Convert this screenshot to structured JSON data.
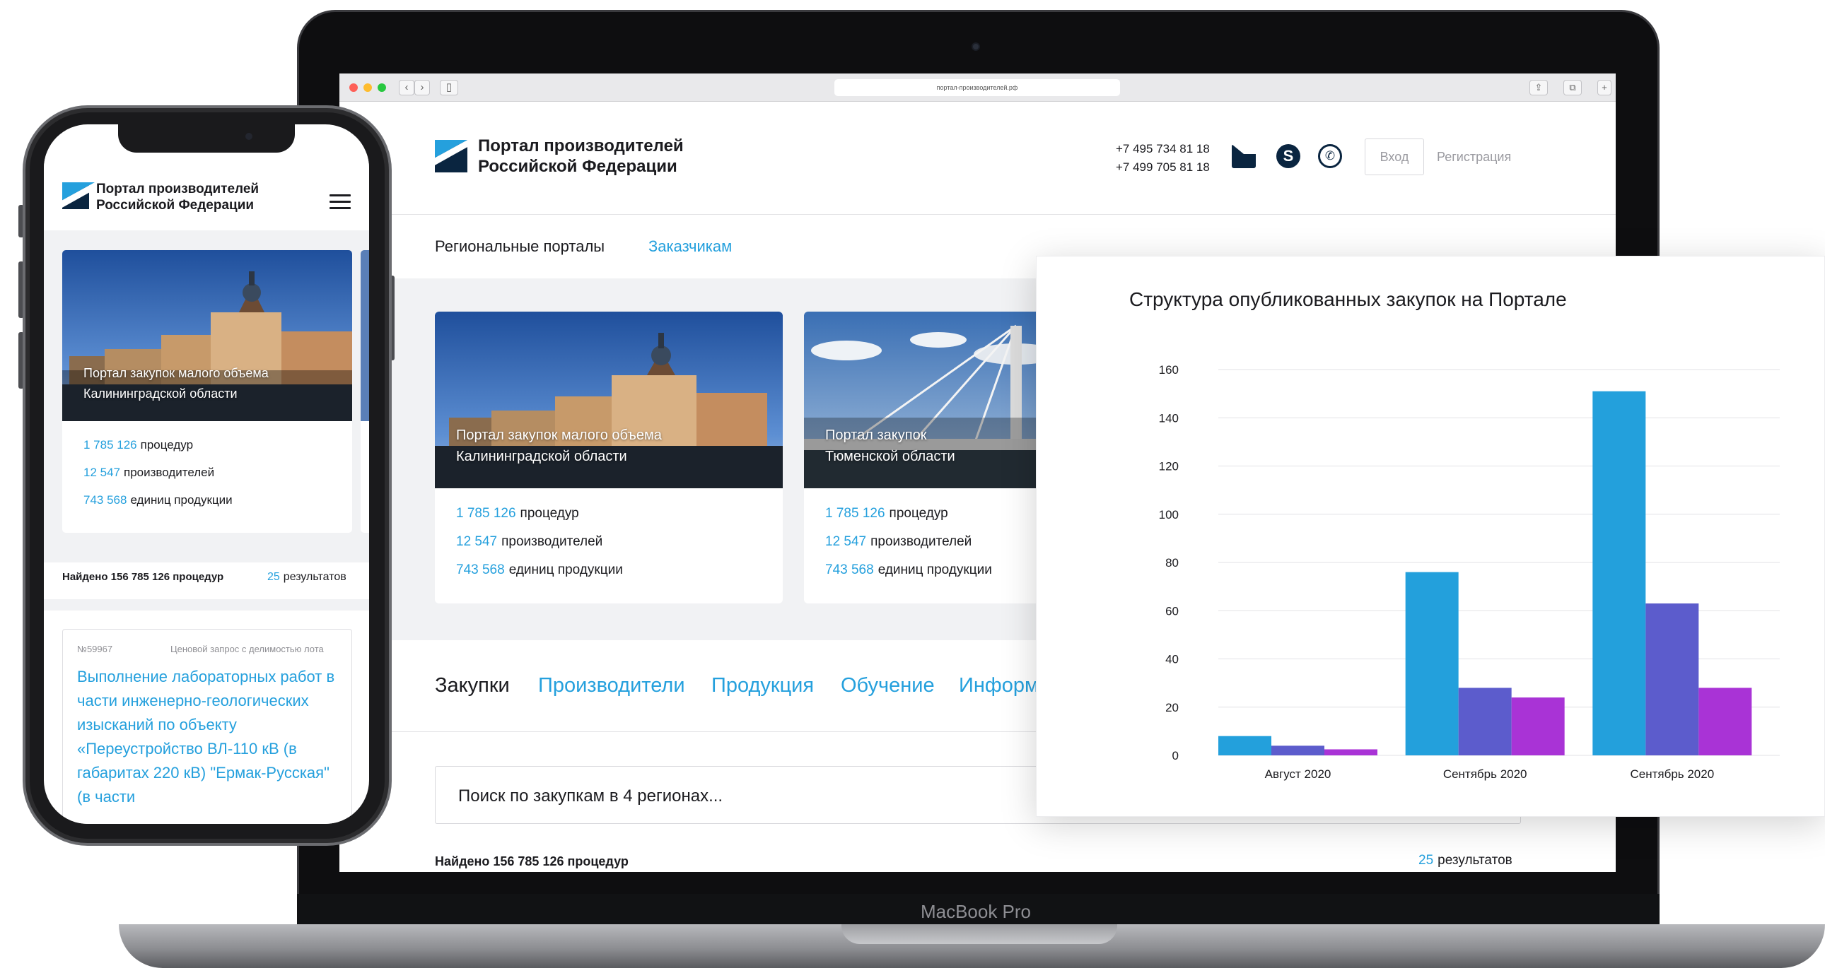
{
  "browser": {
    "url": "портал-производителей.рф"
  },
  "site": {
    "logo_line1": "Портал производителей",
    "logo_line2": "Российской Федерации",
    "phone1": "+7 495 734 81 18",
    "phone2": "+7 499 705 81 18",
    "login": "Вход",
    "register": "Регистрация",
    "skype_glyph": "S",
    "whatsapp_glyph": "✆"
  },
  "subnav": {
    "items": [
      "Региональные порталы",
      "Заказчикам"
    ]
  },
  "cards": [
    {
      "caption1": "Портал закупок малого объема",
      "caption2": "Калининградской области",
      "stats": [
        {
          "num": "1 785 126",
          "label": "процедур"
        },
        {
          "num": "12 547",
          "label": "производителей"
        },
        {
          "num": "743 568",
          "label": "единиц продукции"
        }
      ]
    },
    {
      "caption1": "Портал закупок",
      "caption2": "Тюменской области",
      "stats": [
        {
          "num": "1 785 126",
          "label": "процедур"
        },
        {
          "num": "12 547",
          "label": "производителей"
        },
        {
          "num": "743 568",
          "label": "единиц продукции"
        }
      ]
    }
  ],
  "tabs": [
    "Закупки",
    "Производители",
    "Продукция",
    "Обучение",
    "Информ"
  ],
  "search": {
    "placeholder": "Поиск по закупкам в 4 регионах..."
  },
  "results": {
    "found": "Найдено 156 785 126 процедур",
    "count": "25",
    "label": "результатов"
  },
  "laptop": {
    "brand": "MacBook Pro"
  },
  "phone": {
    "logo_line1": "Портал производителей",
    "logo_line2": "Российской Федерации",
    "card": {
      "caption1": "Портал закупок малого объема",
      "caption2": "Калининградской области",
      "stats": [
        {
          "num": "1 785 126",
          "label": "процедур"
        },
        {
          "num": "12 547",
          "label": "производителей"
        },
        {
          "num": "743 568",
          "label": "единиц продукции"
        }
      ]
    },
    "found": "Найдено 156 785 126 процедур",
    "results_count": "25",
    "results_label": "результатов",
    "tender": {
      "id": "№59967",
      "type": "Ценовой запрос с делимостью лота",
      "title": "Выполнение лабораторных работ в части инженерно-геологических изысканий по объекту «Переустройство ВЛ-110 кВ (в габаритах 220 кВ) \"Ермак-Русская\" (в части"
    }
  },
  "colors": {
    "accent": "#25a0dd",
    "navy": "#0a2540",
    "series1": "#23a0dc",
    "series2": "#5c5ccc",
    "series3": "#a933d6"
  },
  "chart_data": {
    "type": "bar",
    "title": "Структура опубликованных закупок на Портале",
    "categories": [
      "Август 2020",
      "Сентябрь 2020",
      "Сентябрь 2020"
    ],
    "series": [
      {
        "values": [
          8,
          76,
          151
        ]
      },
      {
        "values": [
          4,
          28,
          63
        ]
      },
      {
        "values": [
          2.5,
          24,
          28
        ]
      }
    ],
    "ylim": [
      0,
      160
    ],
    "yticks": [
      0,
      20,
      40,
      60,
      80,
      100,
      120,
      140,
      160
    ],
    "grid": true,
    "legend": "none"
  }
}
